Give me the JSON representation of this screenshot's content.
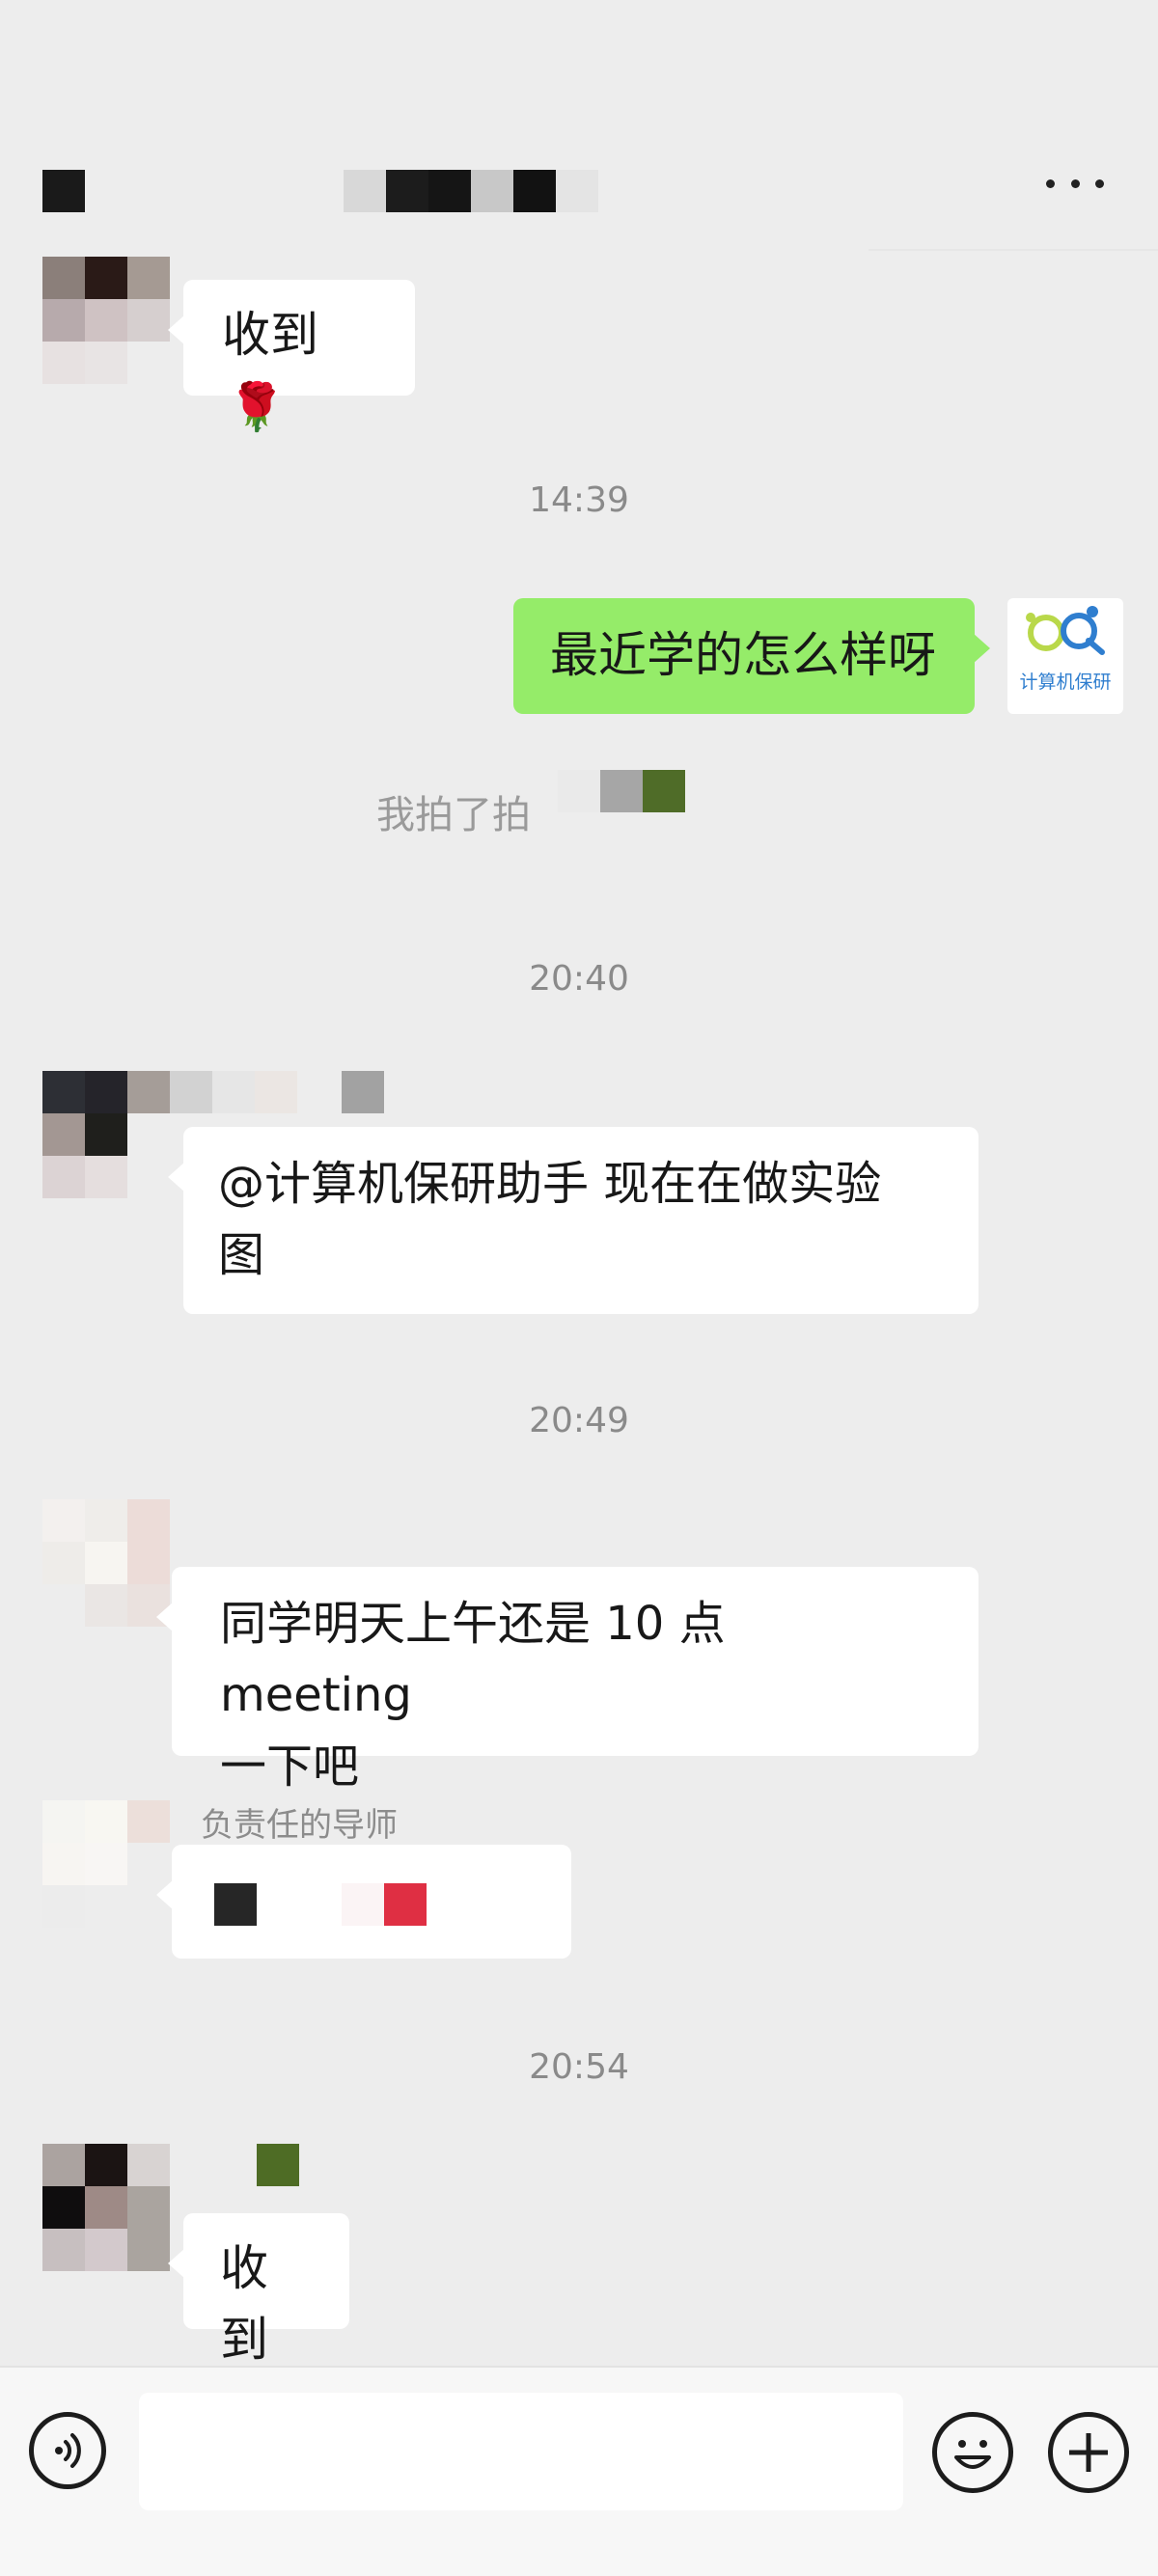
{
  "header": {
    "more_icon": "more-dots-icon"
  },
  "messages": [
    {
      "id": "m1",
      "side": "left",
      "text": "收到",
      "emoji": "🌹"
    },
    {
      "id": "t1",
      "type": "timestamp",
      "text": "14:39"
    },
    {
      "id": "m2",
      "side": "right",
      "text": "最近学的怎么样呀"
    },
    {
      "id": "s1",
      "type": "system",
      "text": "我拍了拍"
    },
    {
      "id": "t2",
      "type": "timestamp",
      "text": "20:40"
    },
    {
      "id": "m3",
      "side": "left",
      "line1": "@计算机保研助手  现在在做实验",
      "line2": "图"
    },
    {
      "id": "t3",
      "type": "timestamp",
      "text": "20:49"
    },
    {
      "id": "m4",
      "side": "left",
      "line1": "同学明天上午还是 10 点 meeting",
      "line2": "一下吧"
    },
    {
      "id": "m5",
      "side": "left",
      "sender": "负责任的导师"
    },
    {
      "id": "t4",
      "type": "timestamp",
      "text": "20:54"
    },
    {
      "id": "m6",
      "side": "left",
      "text": "收到"
    }
  ],
  "self_avatar": {
    "label": "计算机保研"
  },
  "composer": {
    "input_value": "",
    "voice_icon": "voice-icon",
    "emoji_icon": "emoji-icon",
    "plus_icon": "plus-icon"
  },
  "colors": {
    "background": "#ededed",
    "bubble_self": "#95ec69",
    "bubble_other": "#ffffff"
  }
}
